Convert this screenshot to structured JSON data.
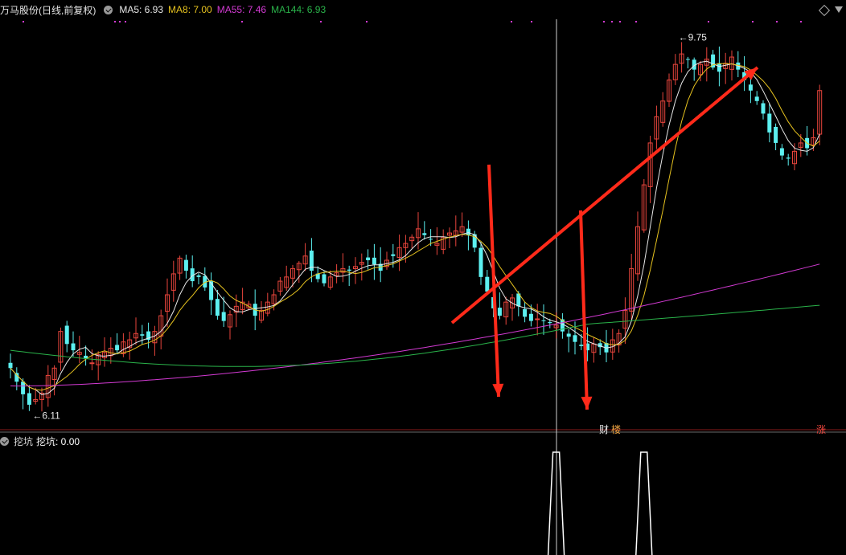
{
  "header": {
    "title": "万马股份(日线,前复权)",
    "ma5_label": "MA5: 6.93",
    "ma8_label": "MA8: 7.00",
    "ma55_label": "MA55: 7.46",
    "ma144_label": "MA144: 6.93"
  },
  "subpanel": {
    "name": "挖坑",
    "value_label": "挖坑: 0.00"
  },
  "markers": {
    "cai": "财",
    "lou": "楼",
    "zhang": "涨"
  },
  "colors": {
    "up": "#e8453c",
    "down": "#5cf0f0",
    "ma5": "#e8e8e8",
    "ma8": "#e6c21f",
    "ma55": "#d23ad2",
    "ma144": "#2ab34a",
    "arrow": "#ff2a1a"
  },
  "chart_data": {
    "type": "candlestick",
    "symbol": "万马股份",
    "period": "日线",
    "adjust": "前复权",
    "low_label": "6.11",
    "high_label": "9.75",
    "price_ylim": [
      6.0,
      9.85
    ],
    "closes": [
      6.55,
      6.42,
      6.3,
      6.2,
      6.25,
      6.31,
      6.48,
      6.55,
      6.9,
      6.78,
      6.72,
      6.7,
      6.64,
      6.6,
      6.68,
      6.7,
      6.74,
      6.72,
      6.8,
      6.82,
      6.88,
      6.86,
      6.82,
      6.9,
      7.05,
      7.25,
      7.45,
      7.6,
      7.48,
      7.38,
      7.42,
      7.32,
      7.2,
      7.05,
      7.0,
      7.06,
      7.14,
      7.18,
      7.16,
      7.05,
      7.1,
      7.18,
      7.25,
      7.38,
      7.42,
      7.5,
      7.55,
      7.62,
      7.48,
      7.4,
      7.36,
      7.42,
      7.46,
      7.5,
      7.48,
      7.52,
      7.56,
      7.58,
      7.54,
      7.48,
      7.58,
      7.62,
      7.7,
      7.74,
      7.8,
      7.88,
      7.82,
      7.78,
      7.74,
      7.8,
      7.84,
      7.86,
      7.9,
      7.82,
      7.7,
      7.42,
      7.28,
      7.12,
      7.05,
      7.18,
      7.22,
      7.14,
      7.04,
      7.0,
      7.02,
      7.0,
      6.98,
      6.96,
      6.9,
      6.85,
      6.8,
      6.76,
      6.72,
      6.78,
      6.75,
      6.7,
      6.82,
      6.88,
      7.1,
      7.5,
      7.9,
      8.3,
      8.7,
      8.95,
      9.1,
      9.3,
      9.45,
      9.55,
      9.5,
      9.4,
      9.45,
      9.5,
      9.42,
      9.38,
      9.46,
      9.52,
      9.4,
      9.3,
      9.2,
      9.1,
      8.98,
      8.8,
      8.7,
      8.58,
      8.55,
      8.62,
      8.7,
      8.65,
      8.75,
      9.2
    ],
    "ma55_endpoint": 7.46,
    "ma144_endpoint": 6.93,
    "wakeng_signal_bars": [
      87,
      101
    ]
  }
}
